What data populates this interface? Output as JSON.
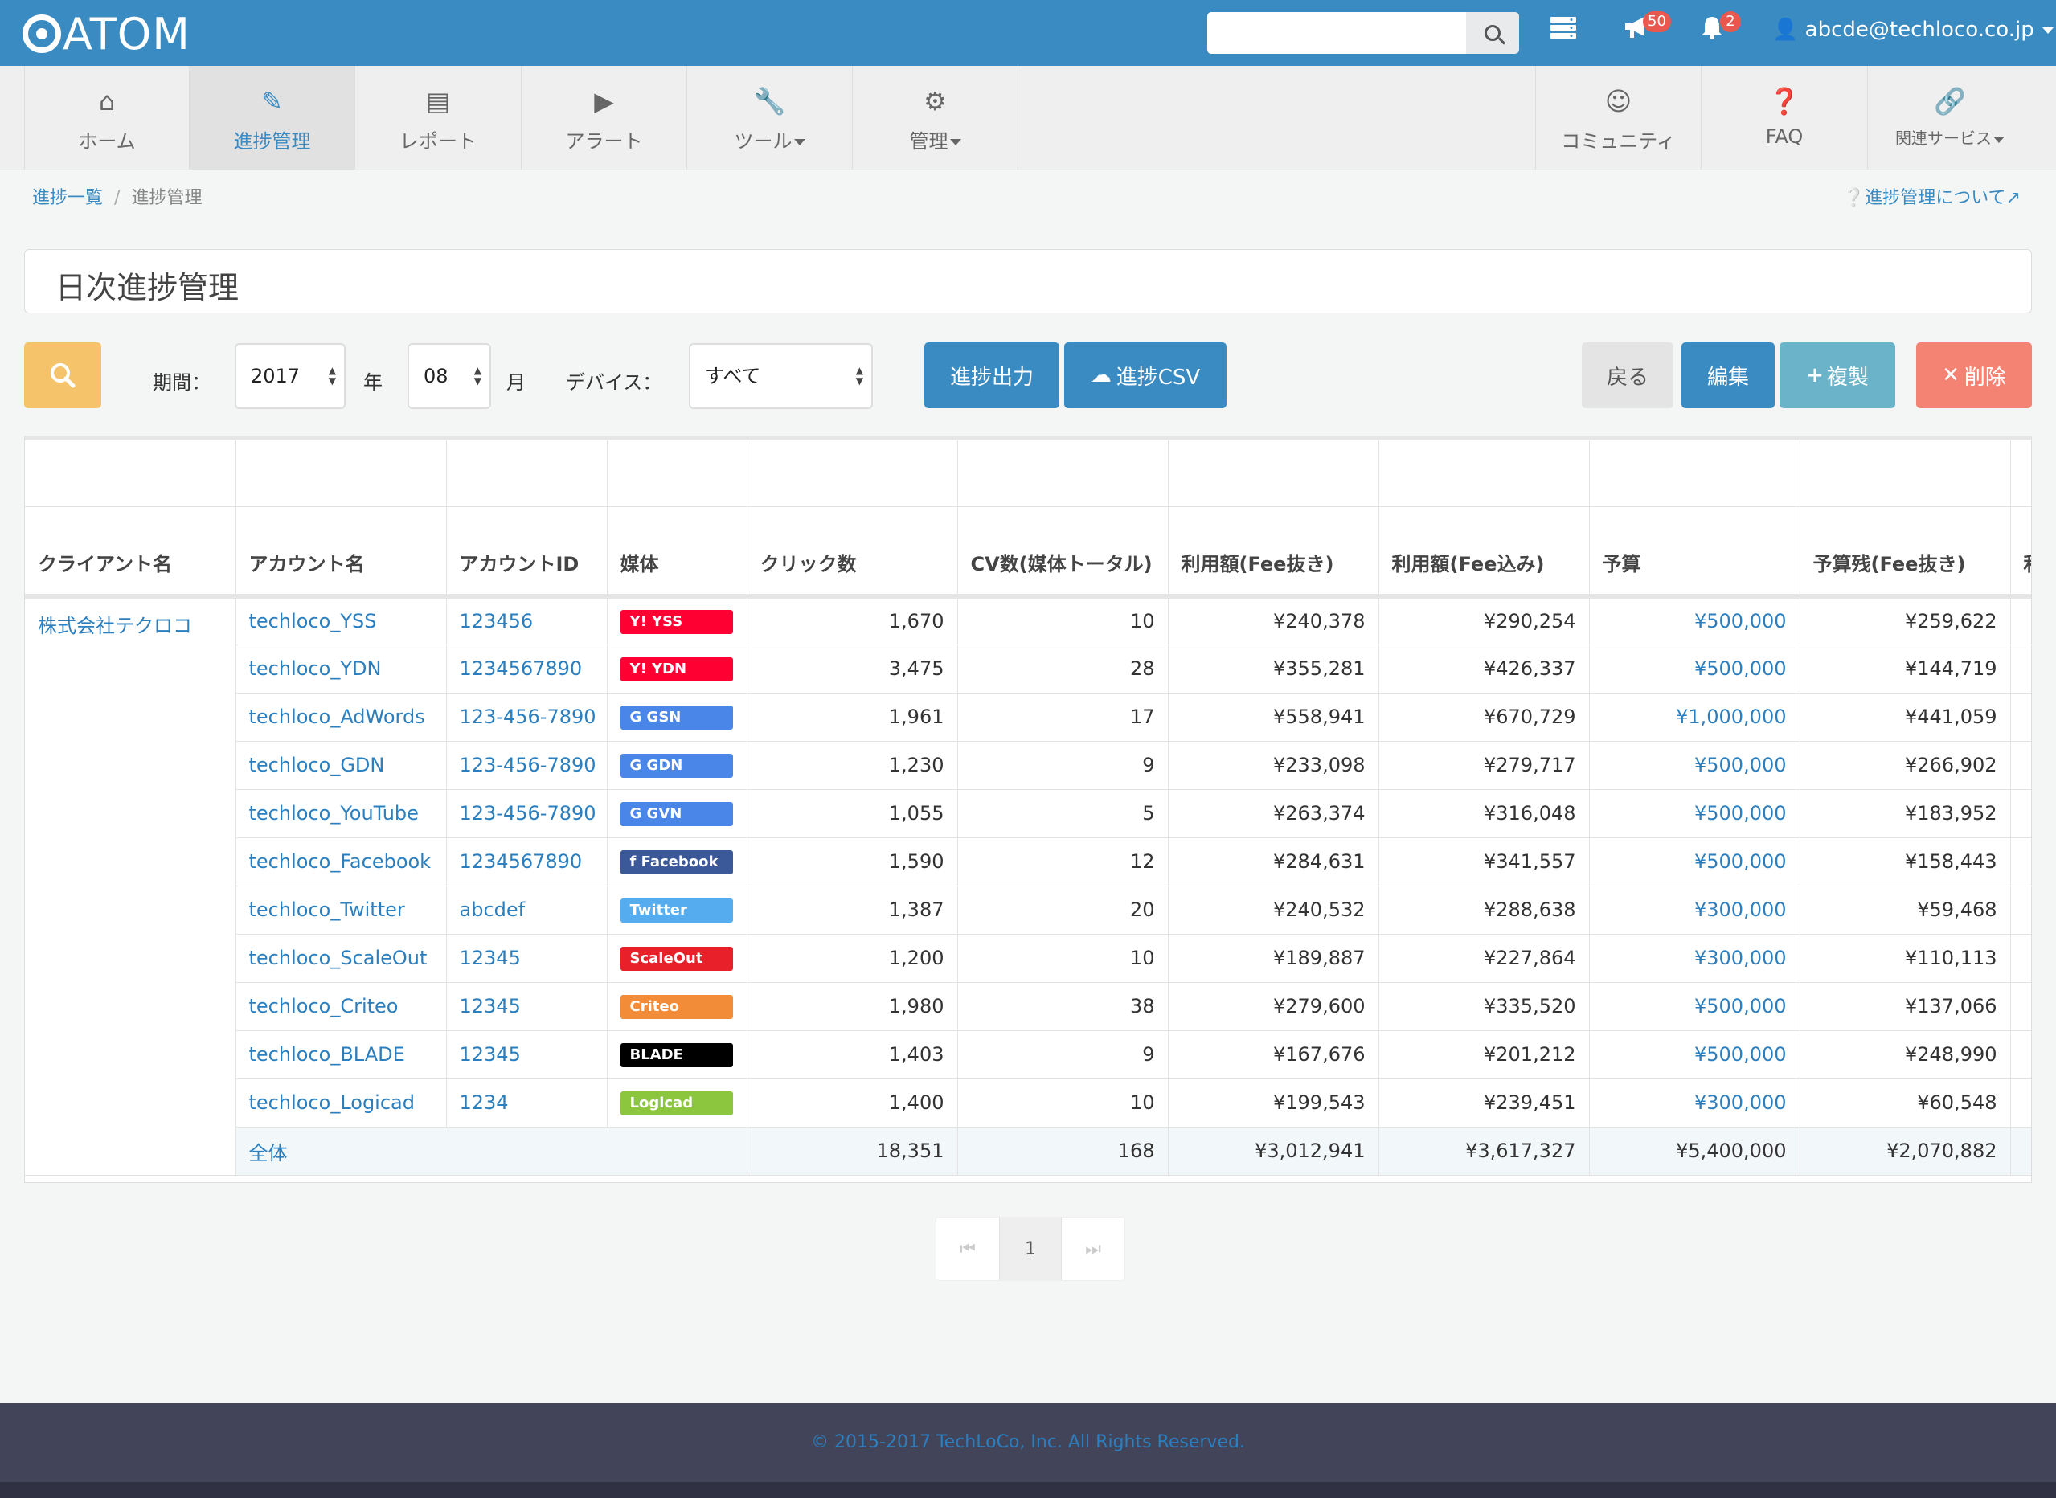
{
  "header": {
    "logo": "ATOM",
    "search": {
      "value": "",
      "placeholder": ""
    },
    "megaphone_badge": "50",
    "bell_badge": "2",
    "user": "abcde@techloco.co.jp"
  },
  "nav": {
    "home": "ホーム",
    "progress": "進捗管理",
    "report": "レポート",
    "alert": "アラート",
    "tools": "ツール",
    "admin": "管理",
    "community": "コミュニティ",
    "faq": "FAQ",
    "services": "関連サービス"
  },
  "breadcrumb": {
    "parent": "進捗一覧",
    "separator": "/",
    "current": "進捗管理",
    "about": "進捗管理について"
  },
  "page_title": "日次進捗管理",
  "filters": {
    "period_label": "期間：",
    "year": "2017",
    "year_unit": "年",
    "month": "08",
    "month_unit": "月",
    "device_label": "デバイス：",
    "device": "すべて"
  },
  "actions": {
    "output": "進捗出力",
    "csv": "進捗CSV",
    "back": "戻る",
    "edit": "編集",
    "copy": "複製",
    "delete": "削除"
  },
  "table": {
    "headers": [
      "クライアント名",
      "アカウント名",
      "アカウントID",
      "媒体",
      "クリック数",
      "CV数(媒体トータル)",
      "利用額(Fee抜き)",
      "利用額(Fee込み)",
      "予算",
      "予算残(Fee抜き)",
      "利"
    ],
    "client": "株式会社テクロコ",
    "rows": [
      {
        "account": "techloco_YSS",
        "id": "123456",
        "media": "Y! YSS",
        "clicks": "1,670",
        "cv": "10",
        "cost": "¥240,378",
        "cost_fee": "¥290,254",
        "budget": "¥500,000",
        "remain": "¥259,622"
      },
      {
        "account": "techloco_YDN",
        "id": "1234567890",
        "media": "Y! YDN",
        "clicks": "3,475",
        "cv": "28",
        "cost": "¥355,281",
        "cost_fee": "¥426,337",
        "budget": "¥500,000",
        "remain": "¥144,719"
      },
      {
        "account": "techloco_AdWords",
        "id": "123-456-7890",
        "media": "G GSN",
        "clicks": "1,961",
        "cv": "17",
        "cost": "¥558,941",
        "cost_fee": "¥670,729",
        "budget": "¥1,000,000",
        "remain": "¥441,059"
      },
      {
        "account": "techloco_GDN",
        "id": "123-456-7890",
        "media": "G GDN",
        "clicks": "1,230",
        "cv": "9",
        "cost": "¥233,098",
        "cost_fee": "¥279,717",
        "budget": "¥500,000",
        "remain": "¥266,902"
      },
      {
        "account": "techloco_YouTube",
        "id": "123-456-7890",
        "media": "G GVN",
        "clicks": "1,055",
        "cv": "5",
        "cost": "¥263,374",
        "cost_fee": "¥316,048",
        "budget": "¥500,000",
        "remain": "¥183,952"
      },
      {
        "account": "techloco_Facebook",
        "id": "1234567890",
        "media": "f Facebook",
        "clicks": "1,590",
        "cv": "12",
        "cost": "¥284,631",
        "cost_fee": "¥341,557",
        "budget": "¥500,000",
        "remain": "¥158,443"
      },
      {
        "account": "techloco_Twitter",
        "id": "abcdef",
        "media": "Twitter",
        "clicks": "1,387",
        "cv": "20",
        "cost": "¥240,532",
        "cost_fee": "¥288,638",
        "budget": "¥300,000",
        "remain": "¥59,468"
      },
      {
        "account": "techloco_ScaleOut",
        "id": "12345",
        "media": "ScaleOut",
        "clicks": "1,200",
        "cv": "10",
        "cost": "¥189,887",
        "cost_fee": "¥227,864",
        "budget": "¥300,000",
        "remain": "¥110,113"
      },
      {
        "account": "techloco_Criteo",
        "id": "12345",
        "media": "Criteo",
        "clicks": "1,980",
        "cv": "38",
        "cost": "¥279,600",
        "cost_fee": "¥335,520",
        "budget": "¥500,000",
        "remain": "¥137,066"
      },
      {
        "account": "techloco_BLADE",
        "id": "12345",
        "media": "BLADE",
        "clicks": "1,403",
        "cv": "9",
        "cost": "¥167,676",
        "cost_fee": "¥201,212",
        "budget": "¥500,000",
        "remain": "¥248,990"
      },
      {
        "account": "techloco_Logicad",
        "id": "1234",
        "media": "Logicad",
        "clicks": "1,400",
        "cv": "10",
        "cost": "¥199,543",
        "cost_fee": "¥239,451",
        "budget": "¥300,000",
        "remain": "¥60,548"
      }
    ],
    "total": {
      "label": "全体",
      "clicks": "18,351",
      "cv": "168",
      "cost": "¥3,012,941",
      "cost_fee": "¥3,617,327",
      "budget": "¥5,400,000",
      "remain": "¥2,070,882"
    },
    "media_colors": {
      "Y! YSS": "#ff0033",
      "Y! YDN": "#ff0033",
      "G GSN": "#4a86e8",
      "G GDN": "#4a86e8",
      "G GVN": "#4a86e8",
      "f Facebook": "#3b5998",
      "Twitter": "#55acee",
      "ScaleOut": "#e8202a",
      "Criteo": "#f28c38",
      "BLADE": "#000000",
      "Logicad": "#8cc63f"
    }
  },
  "pagination": {
    "current": "1"
  },
  "footer": "© 2015-2017 TechLoCo, Inc. All Rights Reserved."
}
